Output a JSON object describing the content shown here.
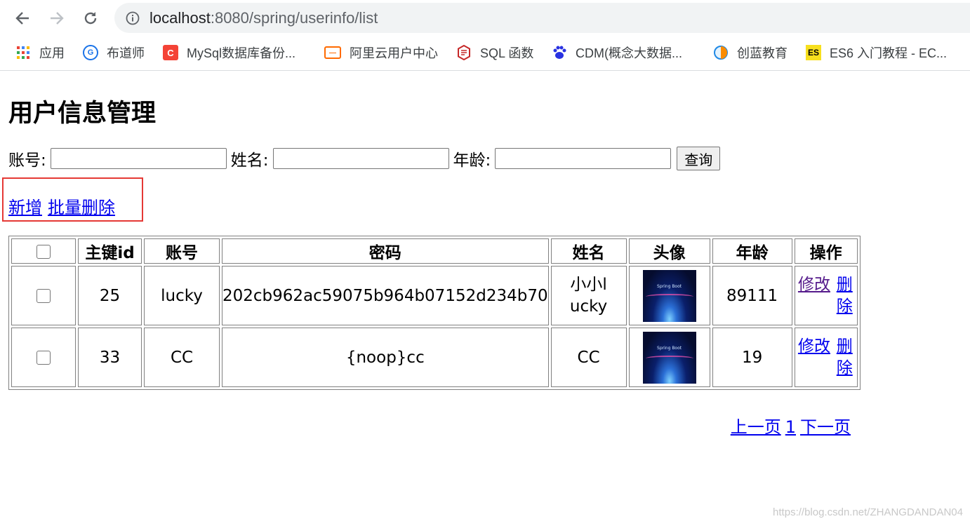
{
  "browser": {
    "url_host": "localhost",
    "url_rest": ":8080/spring/userinfo/list",
    "bookmarks": [
      {
        "label": "应用",
        "icon": "apps-grid-icon",
        "color": "#4285f4"
      },
      {
        "label": "布道师",
        "icon": "budaoshi-icon",
        "color": "#1a73e8"
      },
      {
        "label": "MySql数据库备份...",
        "icon": "csdn-c-icon",
        "color": "#f44336"
      },
      {
        "label": "阿里云用户中心",
        "icon": "aliyun-icon",
        "color": "#ff6a00"
      },
      {
        "label": "SQL 函数",
        "icon": "w3school-icon",
        "color": "#c62828"
      },
      {
        "label": "CDM(概念大数据...",
        "icon": "baidu-paw-icon",
        "color": "#2932e1"
      },
      {
        "label": "创蓝教育",
        "icon": "chuanglan-icon",
        "color": "#1e88e5"
      },
      {
        "label": "ES6 入门教程 - EC...",
        "icon": "es-icon",
        "color": "#f7df1e"
      }
    ]
  },
  "page": {
    "title": "用户信息管理",
    "search": {
      "account_label": "账号:",
      "name_label": "姓名:",
      "age_label": "年龄:",
      "account_value": "",
      "name_value": "",
      "age_value": "",
      "query_button": "查询"
    },
    "actions": {
      "add": "新增",
      "batch_delete": "批量删除"
    },
    "table": {
      "headers": [
        "主键id",
        "账号",
        "密码",
        "姓名",
        "头像",
        "年龄",
        "操作"
      ],
      "rows": [
        {
          "id": "25",
          "account": "lucky",
          "password": "202cb962ac59075b964b07152d234b70",
          "name": "小小lucky",
          "age": "89111",
          "edit": "修改",
          "delete": "删除"
        },
        {
          "id": "33",
          "account": "CC",
          "password": "{noop}cc",
          "name": "CC",
          "age": "19",
          "edit": "修改",
          "delete": "删除"
        }
      ]
    },
    "pager": {
      "prev": "上一页",
      "current": "1",
      "next": "下一页"
    },
    "watermark": "https://blog.csdn.net/ZHANGDANDAN04"
  }
}
